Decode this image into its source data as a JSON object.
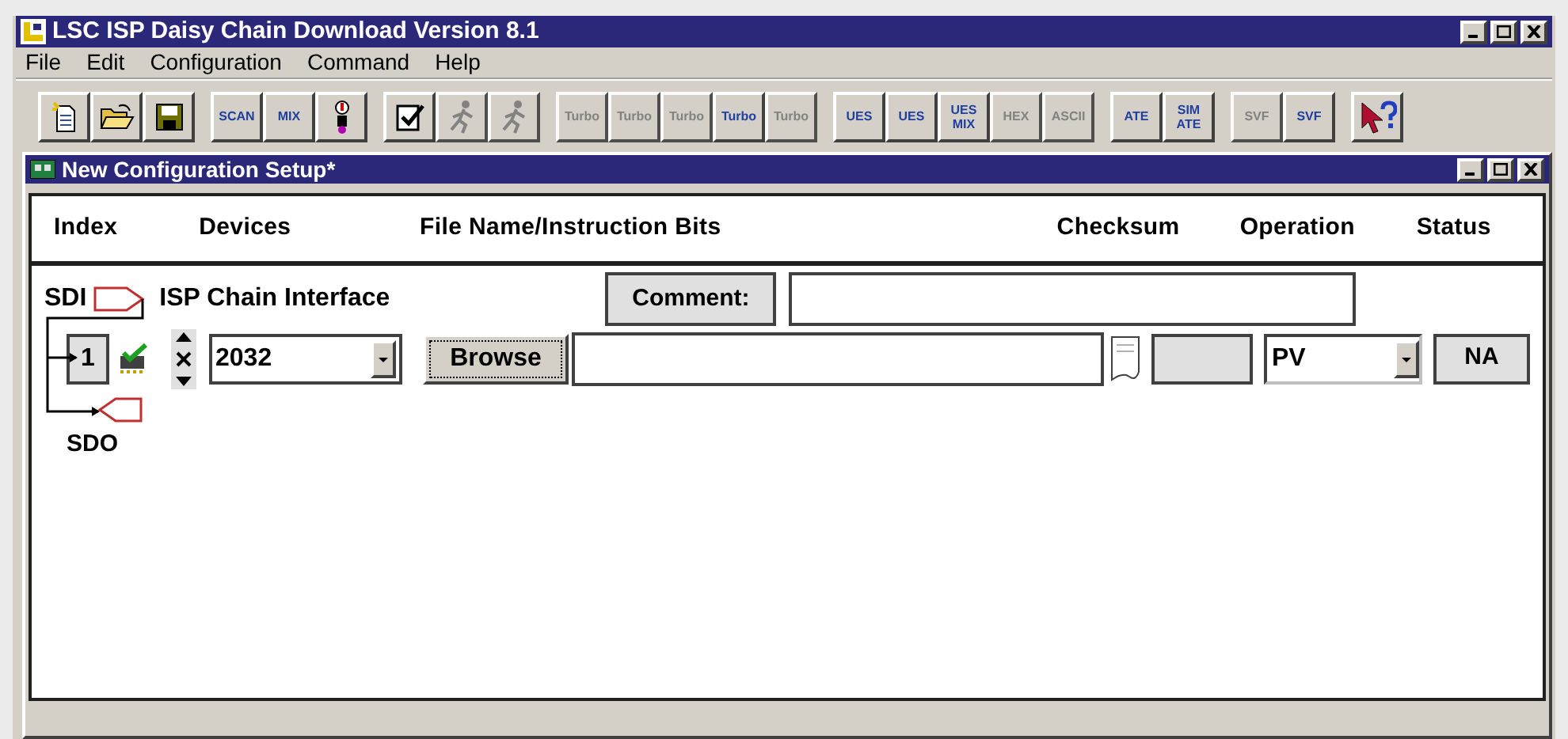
{
  "window": {
    "title": "LSC ISP Daisy Chain Download Version 8.1"
  },
  "menu": [
    {
      "label": "File"
    },
    {
      "label": "Edit"
    },
    {
      "label": "Configuration"
    },
    {
      "label": "Command"
    },
    {
      "label": "Help"
    }
  ],
  "toolbar": {
    "groups": [
      {
        "buttons": [
          {
            "kind": "new",
            "disabled": false
          },
          {
            "kind": "open",
            "disabled": false
          },
          {
            "kind": "save",
            "disabled": false
          }
        ]
      },
      {
        "buttons": [
          {
            "kind": "text",
            "lines": [
              "SCAN"
            ],
            "disabled": false
          },
          {
            "kind": "text",
            "lines": [
              "MIX"
            ],
            "disabled": false
          },
          {
            "kind": "robot",
            "disabled": false
          }
        ]
      },
      {
        "buttons": [
          {
            "kind": "check",
            "disabled": false
          },
          {
            "kind": "runner",
            "disabled": true
          },
          {
            "kind": "runner",
            "disabled": true
          }
        ]
      },
      {
        "buttons": [
          {
            "kind": "text",
            "lines": [
              "Turbo"
            ],
            "disabled": true
          },
          {
            "kind": "text",
            "lines": [
              "Turbo"
            ],
            "disabled": true
          },
          {
            "kind": "text",
            "lines": [
              "Turbo"
            ],
            "disabled": true
          },
          {
            "kind": "text",
            "lines": [
              "Turbo"
            ],
            "disabled": false
          },
          {
            "kind": "text",
            "lines": [
              "Turbo"
            ],
            "disabled": true
          }
        ]
      },
      {
        "buttons": [
          {
            "kind": "text",
            "lines": [
              "UES"
            ],
            "disabled": false
          },
          {
            "kind": "text",
            "lines": [
              "UES"
            ],
            "disabled": false
          },
          {
            "kind": "text",
            "lines": [
              "UES",
              "MIX"
            ],
            "disabled": false
          },
          {
            "kind": "text",
            "lines": [
              "HEX"
            ],
            "disabled": true
          },
          {
            "kind": "text",
            "lines": [
              "ASCII"
            ],
            "disabled": true
          }
        ]
      },
      {
        "buttons": [
          {
            "kind": "text",
            "lines": [
              "ATE"
            ],
            "disabled": false
          },
          {
            "kind": "text",
            "lines": [
              "SIM",
              "ATE"
            ],
            "disabled": false
          }
        ]
      },
      {
        "buttons": [
          {
            "kind": "text",
            "lines": [
              "SVF"
            ],
            "disabled": true
          },
          {
            "kind": "text",
            "lines": [
              "SVF"
            ],
            "disabled": false
          }
        ]
      },
      {
        "buttons": [
          {
            "kind": "help",
            "disabled": false
          }
        ]
      }
    ]
  },
  "child_window": {
    "title": "New Configuration Setup*",
    "columns": [
      "Index",
      "Devices",
      "File Name/Instruction Bits",
      "Checksum",
      "Operation",
      "Status"
    ],
    "chain": {
      "input_label": "SDI",
      "title": "ISP Chain Interface",
      "comment_button": "Comment:",
      "output_label": "SDO"
    },
    "devices": [
      {
        "index": "1",
        "device": "2032",
        "browse": "Browse",
        "operation": "PV",
        "status": "NA"
      }
    ]
  }
}
